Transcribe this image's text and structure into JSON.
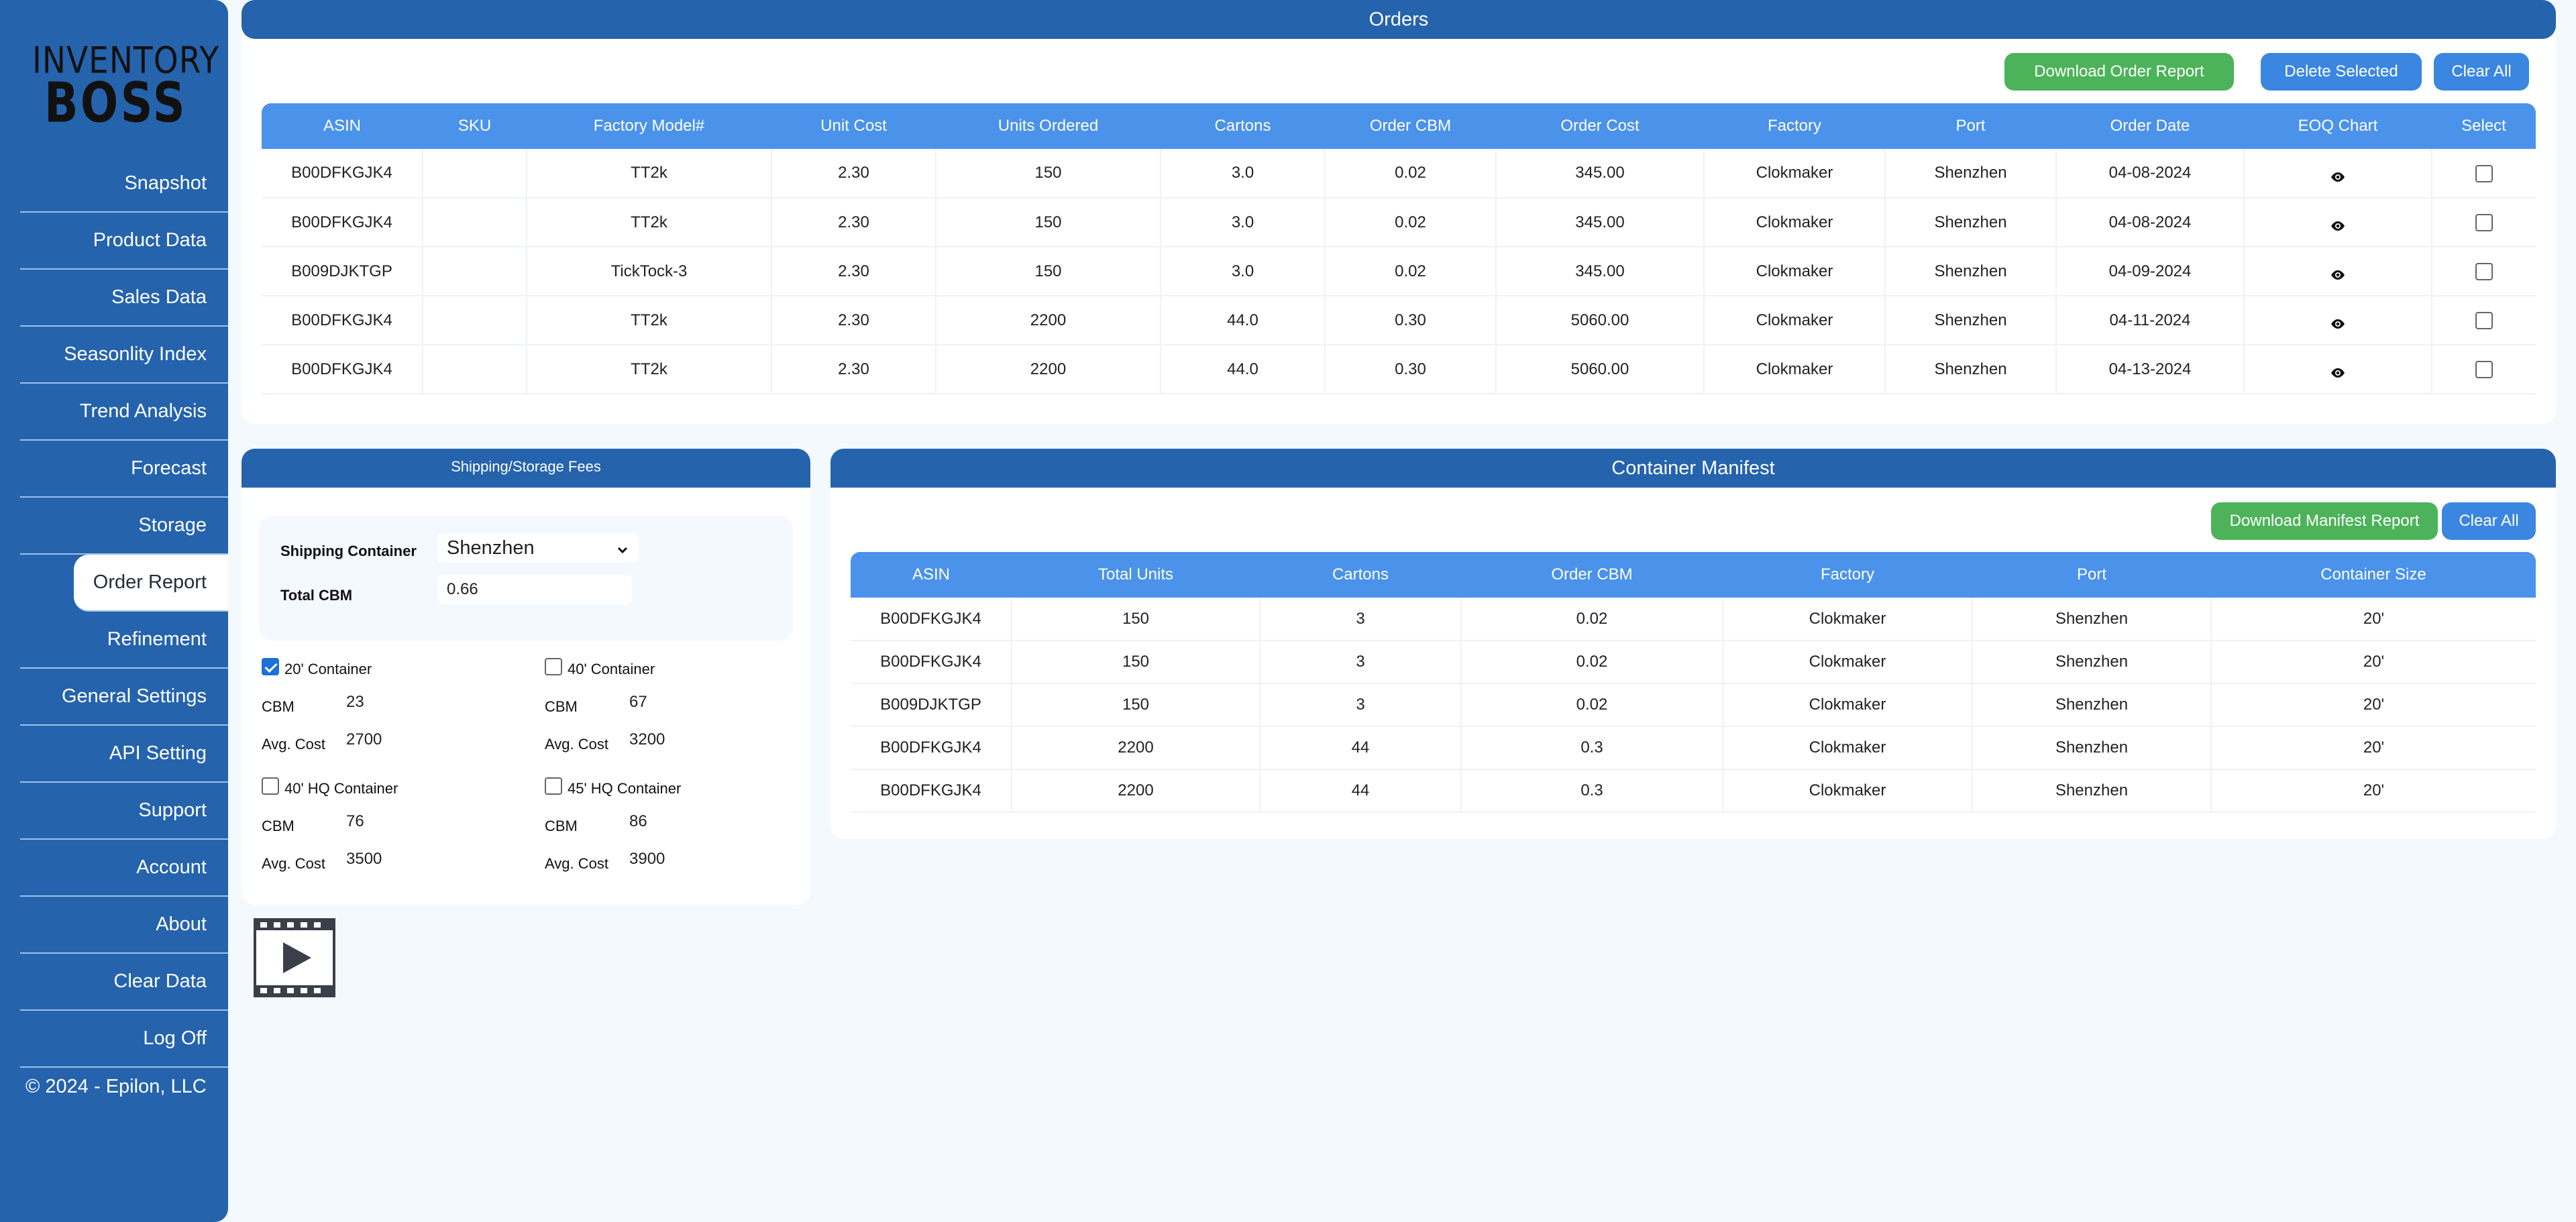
{
  "app": {
    "logo_line1": "INVENTORY",
    "logo_line2": "BOSS",
    "copyright": "© 2024 - Epilon, LLC"
  },
  "sidebar": {
    "items": [
      {
        "label": "Snapshot"
      },
      {
        "label": "Product Data"
      },
      {
        "label": "Sales Data"
      },
      {
        "label": "Seasonlity Index"
      },
      {
        "label": "Trend Analysis"
      },
      {
        "label": "Forecast"
      },
      {
        "label": "Storage"
      },
      {
        "label": "Order Report",
        "active": true
      },
      {
        "label": "Refinement"
      },
      {
        "label": "General Settings"
      },
      {
        "label": "API Setting"
      },
      {
        "label": "Support"
      },
      {
        "label": "Account"
      },
      {
        "label": "About"
      },
      {
        "label": "Clear Data"
      },
      {
        "label": "Log Off"
      }
    ]
  },
  "orders": {
    "title": "Orders",
    "buttons": {
      "download": "Download Order Report",
      "delete": "Delete Selected",
      "clear": "Clear All"
    },
    "columns": [
      "ASIN",
      "SKU",
      "Factory Model#",
      "Unit Cost",
      "Units Ordered",
      "Cartons",
      "Order CBM",
      "Order Cost",
      "Factory",
      "Port",
      "Order Date",
      "EOQ Chart",
      "Select"
    ],
    "rows": [
      {
        "asin": "B00DFKGJK4",
        "sku": "",
        "model": "TT2k",
        "unit_cost": "2.30",
        "units": "150",
        "cartons": "3.0",
        "cbm": "0.02",
        "cost": "345.00",
        "factory": "Clokmaker",
        "port": "Shenzhen",
        "date": "04-08-2024"
      },
      {
        "asin": "B00DFKGJK4",
        "sku": "",
        "model": "TT2k",
        "unit_cost": "2.30",
        "units": "150",
        "cartons": "3.0",
        "cbm": "0.02",
        "cost": "345.00",
        "factory": "Clokmaker",
        "port": "Shenzhen",
        "date": "04-08-2024"
      },
      {
        "asin": "B009DJKTGP",
        "sku": "",
        "model": "TickTock-3",
        "unit_cost": "2.30",
        "units": "150",
        "cartons": "3.0",
        "cbm": "0.02",
        "cost": "345.00",
        "factory": "Clokmaker",
        "port": "Shenzhen",
        "date": "04-09-2024"
      },
      {
        "asin": "B00DFKGJK4",
        "sku": "",
        "model": "TT2k",
        "unit_cost": "2.30",
        "units": "2200",
        "cartons": "44.0",
        "cbm": "0.30",
        "cost": "5060.00",
        "factory": "Clokmaker",
        "port": "Shenzhen",
        "date": "04-11-2024"
      },
      {
        "asin": "B00DFKGJK4",
        "sku": "",
        "model": "TT2k",
        "unit_cost": "2.30",
        "units": "2200",
        "cartons": "44.0",
        "cbm": "0.30",
        "cost": "5060.00",
        "factory": "Clokmaker",
        "port": "Shenzhen",
        "date": "04-13-2024"
      }
    ]
  },
  "shipping": {
    "title": "Shipping/Storage Fees",
    "container_label": "Shipping Container",
    "container_value": "Shenzhen",
    "total_cbm_label": "Total CBM",
    "total_cbm_value": "0.66",
    "containers": [
      {
        "name": "20' Container",
        "checked": true,
        "cbm_label": "CBM",
        "cbm": "23",
        "cost_label": "Avg. Cost",
        "cost": "2700"
      },
      {
        "name": "40' Container",
        "checked": false,
        "cbm_label": "CBM",
        "cbm": "67",
        "cost_label": "Avg. Cost",
        "cost": "3200"
      },
      {
        "name": "40' HQ Container",
        "checked": false,
        "cbm_label": "CBM",
        "cbm": "76",
        "cost_label": "Avg. Cost",
        "cost": "3500"
      },
      {
        "name": "45' HQ Container",
        "checked": false,
        "cbm_label": "CBM",
        "cbm": "86",
        "cost_label": "Avg. Cost",
        "cost": "3900"
      }
    ]
  },
  "manifest": {
    "title": "Container Manifest",
    "buttons": {
      "download": "Download Manifest Report",
      "clear": "Clear All"
    },
    "columns": [
      "ASIN",
      "Total Units",
      "Cartons",
      "Order CBM",
      "Factory",
      "Port",
      "Container Size"
    ],
    "rows": [
      {
        "asin": "B00DFKGJK4",
        "units": "150",
        "cartons": "3",
        "cbm": "0.02",
        "factory": "Clokmaker",
        "port": "Shenzhen",
        "size": "20'"
      },
      {
        "asin": "B00DFKGJK4",
        "units": "150",
        "cartons": "3",
        "cbm": "0.02",
        "factory": "Clokmaker",
        "port": "Shenzhen",
        "size": "20'"
      },
      {
        "asin": "B009DJKTGP",
        "units": "150",
        "cartons": "3",
        "cbm": "0.02",
        "factory": "Clokmaker",
        "port": "Shenzhen",
        "size": "20'"
      },
      {
        "asin": "B00DFKGJK4",
        "units": "2200",
        "cartons": "44",
        "cbm": "0.3",
        "factory": "Clokmaker",
        "port": "Shenzhen",
        "size": "20'"
      },
      {
        "asin": "B00DFKGJK4",
        "units": "2200",
        "cartons": "44",
        "cbm": "0.3",
        "factory": "Clokmaker",
        "port": "Shenzhen",
        "size": "20'"
      }
    ]
  },
  "icons": {
    "eye": "eye-icon",
    "video": "video-play-icon",
    "caret": "chevron-down-icon"
  },
  "colors": {
    "sidebar": "#2563ad",
    "header_row": "#4a92ea",
    "green_button": "#4db35a",
    "blue_button": "#3b86e0",
    "background": "#f4f9fe"
  }
}
